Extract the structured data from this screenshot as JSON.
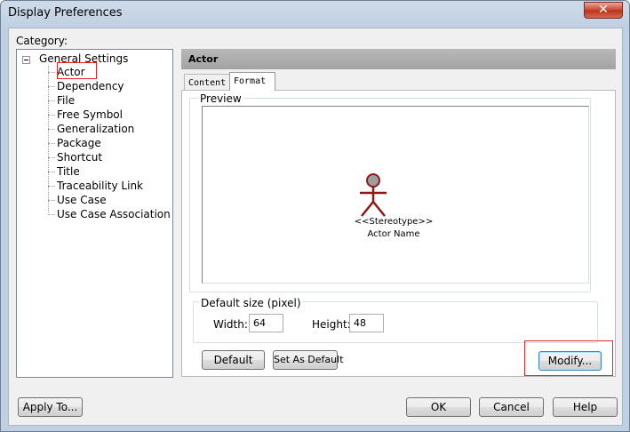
{
  "window": {
    "title": "Display Preferences",
    "close_glyph": "✕"
  },
  "category": {
    "label": "Category:",
    "root": "General Settings",
    "items": [
      "Actor",
      "Dependency",
      "File",
      "Free Symbol",
      "Generalization",
      "Package",
      "Shortcut",
      "Title",
      "Traceability Link",
      "Use Case",
      "Use Case Association"
    ],
    "selected": "Actor"
  },
  "panel": {
    "header": "Actor",
    "tabs": [
      {
        "label": "Content"
      },
      {
        "label": "Format"
      }
    ],
    "active_tab": "Format",
    "preview": {
      "legend": "Preview",
      "stereotype": "<<Stereotype>>",
      "actor_name": "Actor Name",
      "actor_color": "#8b1a1a"
    },
    "default_size": {
      "legend": "Default size (pixel)",
      "width_label": "Width:",
      "width_value": "64",
      "height_label": "Height:",
      "height_value": "48"
    },
    "buttons": {
      "default": "Default",
      "set_as_default": "Set As Default",
      "modify": "Modify..."
    }
  },
  "footer": {
    "apply_to": "Apply To...",
    "ok": "OK",
    "cancel": "Cancel",
    "help": "Help"
  },
  "colors": {
    "highlight": "#e2262a",
    "header_bg": "#a8a8a8"
  }
}
